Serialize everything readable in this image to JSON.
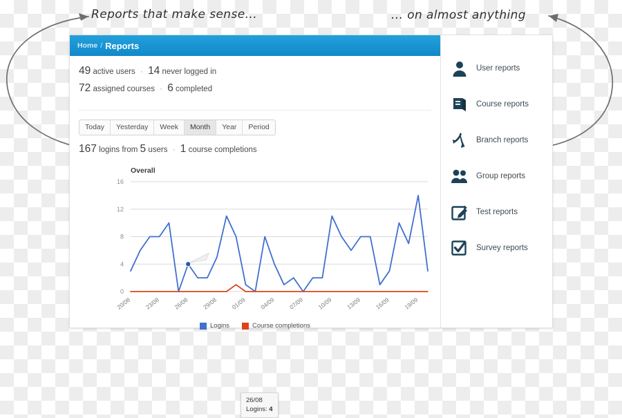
{
  "annotations": {
    "left": "Reports that make sense...",
    "right": "... on almost anything"
  },
  "app": {
    "breadcrumb": {
      "home": "Home",
      "separator": "/",
      "current": "Reports"
    },
    "stats": [
      {
        "value": "49",
        "text_a": "active users",
        "sep": "·",
        "value_b": "14",
        "text_b": "never logged in"
      },
      {
        "value": "72",
        "text_a": "assigned courses",
        "sep": "·",
        "value_b": "6",
        "text_b": "completed"
      }
    ],
    "tabs": [
      {
        "label": "Today",
        "active": false
      },
      {
        "label": "Yesterday",
        "active": false
      },
      {
        "label": "Week",
        "active": false
      },
      {
        "label": "Month",
        "active": true
      },
      {
        "label": "Year",
        "active": false
      },
      {
        "label": "Period",
        "active": false
      }
    ],
    "login_summary": {
      "logins": "167",
      "text_a": "logins from",
      "users": "5",
      "text_b": "users",
      "sep": "·",
      "completions": "1",
      "text_c": "course completions"
    },
    "tooltip": {
      "date": "26/08",
      "label": "Logins:",
      "value": "4"
    },
    "sidebar": {
      "items": [
        {
          "label": "User reports",
          "icon": "user-icon"
        },
        {
          "label": "Course reports",
          "icon": "book-icon"
        },
        {
          "label": "Branch reports",
          "icon": "branch-icon"
        },
        {
          "label": "Group reports",
          "icon": "group-icon"
        },
        {
          "label": "Test reports",
          "icon": "pencil-square-icon"
        },
        {
          "label": "Survey reports",
          "icon": "checkbox-icon"
        }
      ]
    }
  },
  "colors": {
    "header_blue": "#1b94d2",
    "logins_blue": "#3f6fd0",
    "completions_red": "#e0401c",
    "grid_gray": "#d9d9d9"
  },
  "chart_data": {
    "type": "line",
    "title": "Overall",
    "xlabel": "",
    "ylabel": "",
    "ylim": [
      0,
      16
    ],
    "yticks": [
      0,
      4,
      8,
      12,
      16
    ],
    "grid": true,
    "legend_position": "bottom",
    "x": [
      "20/08",
      "21/08",
      "22/08",
      "23/08",
      "24/08",
      "25/08",
      "26/08",
      "27/08",
      "28/08",
      "29/08",
      "30/08",
      "31/08",
      "01/09",
      "02/09",
      "03/09",
      "04/09",
      "05/09",
      "06/09",
      "07/09",
      "08/09",
      "09/09",
      "10/09",
      "11/09",
      "12/09",
      "13/09",
      "14/09",
      "15/09",
      "16/09",
      "17/09",
      "18/09",
      "19/09",
      "20/09"
    ],
    "xtick_labels": [
      "20/08",
      "23/08",
      "26/08",
      "29/08",
      "01/09",
      "04/09",
      "07/09",
      "10/09",
      "13/09",
      "16/09",
      "19/09"
    ],
    "xtick_indices": [
      0,
      3,
      6,
      9,
      12,
      15,
      18,
      21,
      24,
      27,
      30
    ],
    "series": [
      {
        "name": "Logins",
        "color": "#3f6fd0",
        "values": [
          3,
          6,
          8,
          8,
          10,
          0,
          4,
          2,
          2,
          5,
          11,
          8,
          1,
          0,
          8,
          4,
          1,
          2,
          0,
          2,
          2,
          11,
          8,
          6,
          8,
          8,
          1,
          3,
          10,
          7,
          14,
          3
        ]
      },
      {
        "name": "Course completions",
        "color": "#e0401c",
        "values": [
          0,
          0,
          0,
          0,
          0,
          0,
          0,
          0,
          0,
          0,
          0,
          1,
          0,
          0,
          0,
          0,
          0,
          0,
          0,
          0,
          0,
          0,
          0,
          0,
          0,
          0,
          0,
          0,
          0,
          0,
          0,
          0
        ]
      }
    ],
    "highlight_point": {
      "x": "26/08",
      "y": 4,
      "series": "Logins"
    }
  }
}
